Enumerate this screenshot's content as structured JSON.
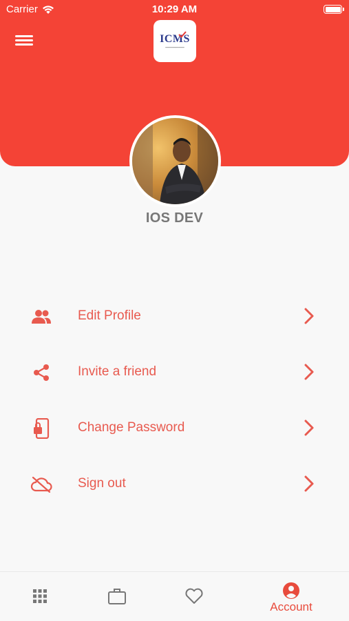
{
  "status_bar": {
    "carrier": "Carrier",
    "time": "10:29 AM"
  },
  "header": {
    "background_color": "#f44336",
    "logo_text": "ICMS"
  },
  "profile": {
    "username": "IOS DEV"
  },
  "menu": {
    "accent_color": "#e85a4f",
    "items": [
      {
        "label": "Edit Profile",
        "icon": "people-icon"
      },
      {
        "label": "Invite a friend",
        "icon": "share-icon"
      },
      {
        "label": "Change Password",
        "icon": "phone-lock-icon"
      },
      {
        "label": "Sign out",
        "icon": "cloud-off-icon"
      }
    ]
  },
  "tab_bar": {
    "tabs": [
      {
        "icon": "grid-icon",
        "label": ""
      },
      {
        "icon": "briefcase-icon",
        "label": ""
      },
      {
        "icon": "heart-icon",
        "label": ""
      },
      {
        "icon": "account-icon",
        "label": "Account",
        "active": true
      }
    ]
  }
}
